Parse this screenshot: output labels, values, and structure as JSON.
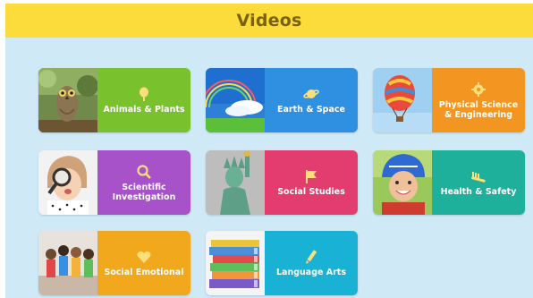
{
  "header": {
    "title": "Videos"
  },
  "cards": [
    {
      "label": "Animals & Plants",
      "icon": "leaf-icon",
      "color": "#79c22e"
    },
    {
      "label": "Earth & Space",
      "icon": "planet-icon",
      "color": "#2f8fe0"
    },
    {
      "label": "Physical Science & Engineering",
      "icon": "gear-icon",
      "color": "#f39621"
    },
    {
      "label": "Scientific Investigation",
      "icon": "magnifier-icon",
      "color": "#a852c9"
    },
    {
      "label": "Social Studies",
      "icon": "flag-icon",
      "color": "#e23d6e"
    },
    {
      "label": "Health & Safety",
      "icon": "toothbrush-icon",
      "color": "#1eb09a"
    },
    {
      "label": "Social Emotional",
      "icon": "heart-icon",
      "color": "#f2a81c"
    },
    {
      "label": "Language Arts",
      "icon": "pencil-icon",
      "color": "#19b2d4"
    }
  ]
}
